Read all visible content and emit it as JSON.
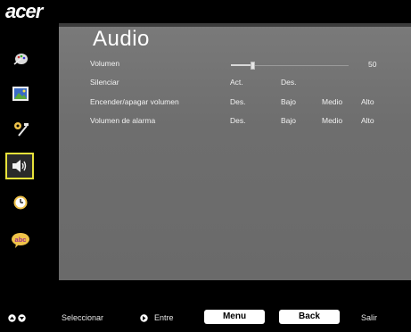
{
  "brand": {
    "logo_text": "acer"
  },
  "sidebar": {
    "items": [
      {
        "name": "color-icon",
        "active": false
      },
      {
        "name": "image-icon",
        "active": false
      },
      {
        "name": "settings-icon",
        "active": false
      },
      {
        "name": "audio-icon",
        "active": true
      },
      {
        "name": "timer-icon",
        "active": false
      },
      {
        "name": "language-icon",
        "active": false,
        "label": "abc"
      }
    ]
  },
  "main": {
    "title": "Audio",
    "rows": [
      {
        "label": "Volumen",
        "slider_value": 0.18,
        "value_text": "50"
      },
      {
        "label": "Silenciar",
        "options": [
          "Act.",
          "Des."
        ]
      },
      {
        "label": "Encender/apagar volumen",
        "options": [
          "Des.",
          "Bajo",
          "Medio",
          "Alto"
        ]
      },
      {
        "label": "Volumen de alarma",
        "options": [
          "Des.",
          "Bajo",
          "Medio",
          "Alto"
        ]
      }
    ]
  },
  "footer": {
    "select_label": "Seleccionar",
    "enter_label": "Entre",
    "menu_button": "Menu",
    "back_button": "Back",
    "exit_label": "Salir"
  },
  "colors": {
    "highlight": "#e8e23a",
    "panel": "#737373",
    "background": "#000000"
  }
}
